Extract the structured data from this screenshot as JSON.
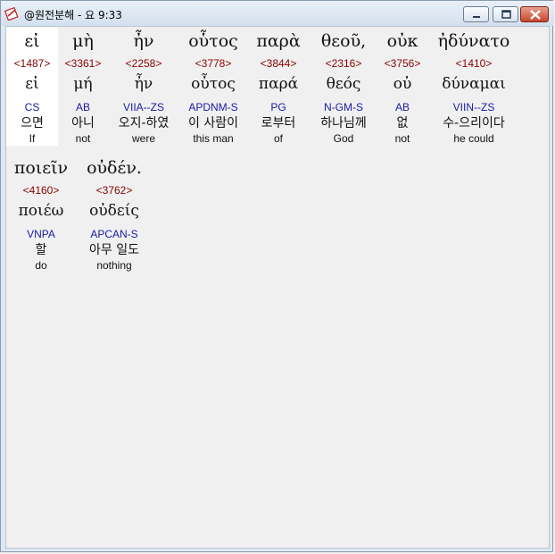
{
  "window": {
    "title": "@원전분해 - 요 9:33"
  },
  "words": [
    {
      "greek": "εἰ",
      "strong": "<1487>",
      "lemma": "εἰ",
      "parse": "CS",
      "korean": "으면",
      "english": "If"
    },
    {
      "greek": "μὴ",
      "strong": "<3361>",
      "lemma": "μή",
      "parse": "AB",
      "korean": "아니",
      "english": "not"
    },
    {
      "greek": "ἦν",
      "strong": "<2258>",
      "lemma": "ἦν",
      "parse": "VIIA--ZS",
      "korean": "오지-하였",
      "english": "were"
    },
    {
      "greek": "οὗτος",
      "strong": "<3778>",
      "lemma": "οὗτος",
      "parse": "APDNM-S",
      "korean": "이 사람이",
      "english": "this man"
    },
    {
      "greek": "παρὰ",
      "strong": "<3844>",
      "lemma": "παρά",
      "parse": "PG",
      "korean": "로부터",
      "english": "of"
    },
    {
      "greek": "θεοῦ,",
      "strong": "<2316>",
      "lemma": "θεός",
      "parse": "N-GM-S",
      "korean": "하나님께",
      "english": "God"
    },
    {
      "greek": "οὐκ",
      "strong": "<3756>",
      "lemma": "οὐ",
      "parse": "AB",
      "korean": "없",
      "english": "not"
    },
    {
      "greek": "ἠδύνατο",
      "strong": "<1410>",
      "lemma": "δύναμαι",
      "parse": "VIIN--ZS",
      "korean": "수-으리이다",
      "english": "he could"
    },
    {
      "greek": "ποιεῖν",
      "strong": "<4160>",
      "lemma": "ποιέω",
      "parse": "VNPA",
      "korean": "할",
      "english": "do"
    },
    {
      "greek": "οὐδέν.",
      "strong": "<3762>",
      "lemma": "οὐδείς",
      "parse": "APCAN-S",
      "korean": "아무 일도",
      "english": "nothing"
    }
  ],
  "icons": {
    "app": "app-icon",
    "minimize": "minimize-icon",
    "maximize": "maximize-icon",
    "close": "close-icon"
  }
}
